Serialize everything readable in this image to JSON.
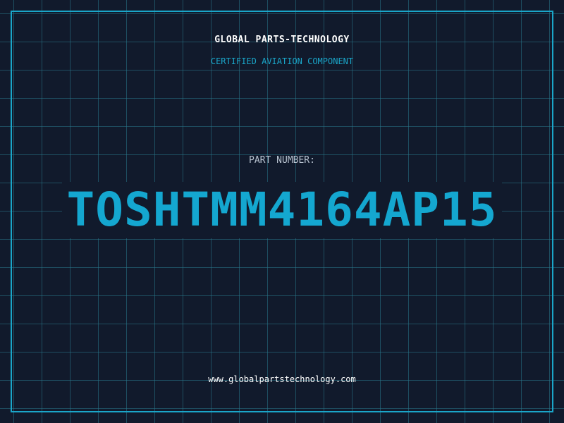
{
  "header": {
    "company": "GLOBAL PARTS-TECHNOLOGY",
    "subtitle": "CERTIFIED AVIATION COMPONENT"
  },
  "part": {
    "label": "PART NUMBER:",
    "number": "TOSHTMM4164AP15"
  },
  "footer": {
    "url": "www.globalpartstechnology.com"
  },
  "colors": {
    "background": "#111a2c",
    "accent": "#1aa6c9",
    "grid": "#29788c",
    "text": "#ffffff"
  }
}
